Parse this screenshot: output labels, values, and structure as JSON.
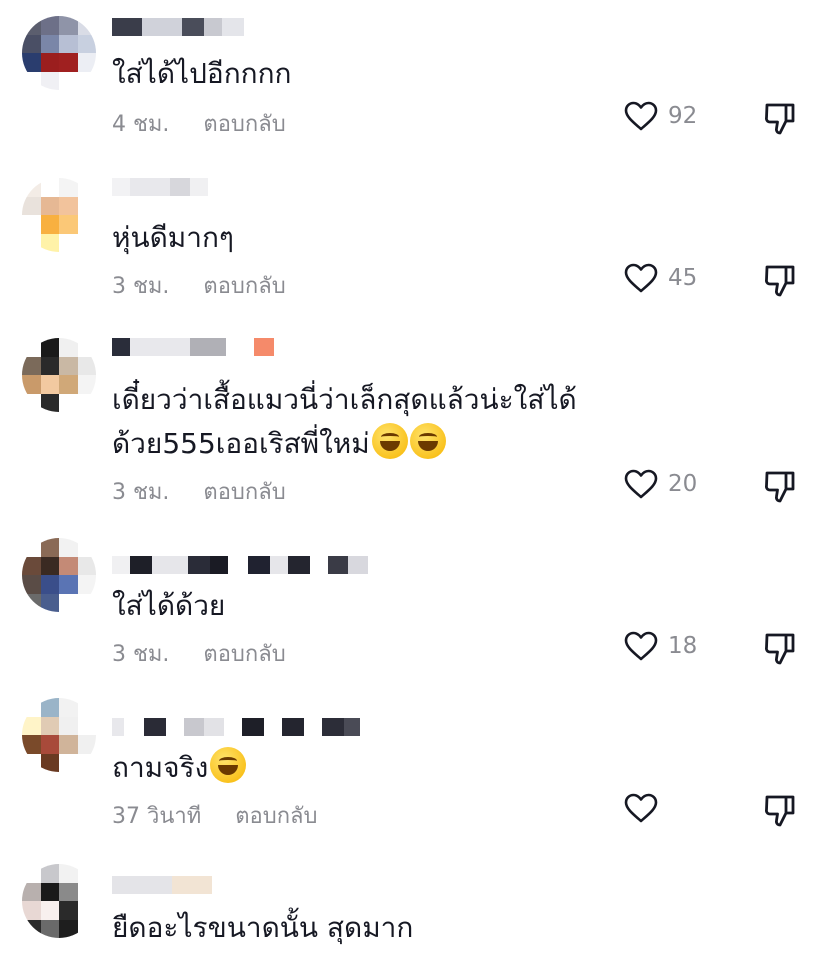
{
  "icons": {
    "like": "heart-outline-icon",
    "dislike": "thumbs-down-icon",
    "emoji_sweat": "grinning-sweat-emoji",
    "emoji_laugh": "tears-of-joy-emoji"
  },
  "comments": [
    {
      "text": "ใส่ได้ไปอีกกกก",
      "time": "4 ชม.",
      "reply": "ตอบกลับ",
      "likes": "92"
    },
    {
      "text": "หุ่นดีมากๆ",
      "time": "3 ชม.",
      "reply": "ตอบกลับ",
      "likes": "45"
    },
    {
      "text_line1": "เดี๋ยวว่าเสื้อแมวนี่ว่าเล็กสุดแล้วน่ะใส่ได้",
      "text_line2": "ด้วย555เออเริสพี่ใหม่",
      "time": "3 ชม.",
      "reply": "ตอบกลับ",
      "likes": "20"
    },
    {
      "text": "ใส่ได้ด้วย",
      "time": "3 ชม.",
      "reply": "ตอบกลับ",
      "likes": "18"
    },
    {
      "text": "ถามจริง",
      "time": "37 วินาที",
      "reply": "ตอบกลับ",
      "likes": ""
    },
    {
      "text": "ยืดอะไรขนาดนั้น สุดมาก",
      "time": "",
      "reply": "",
      "likes": ""
    }
  ]
}
